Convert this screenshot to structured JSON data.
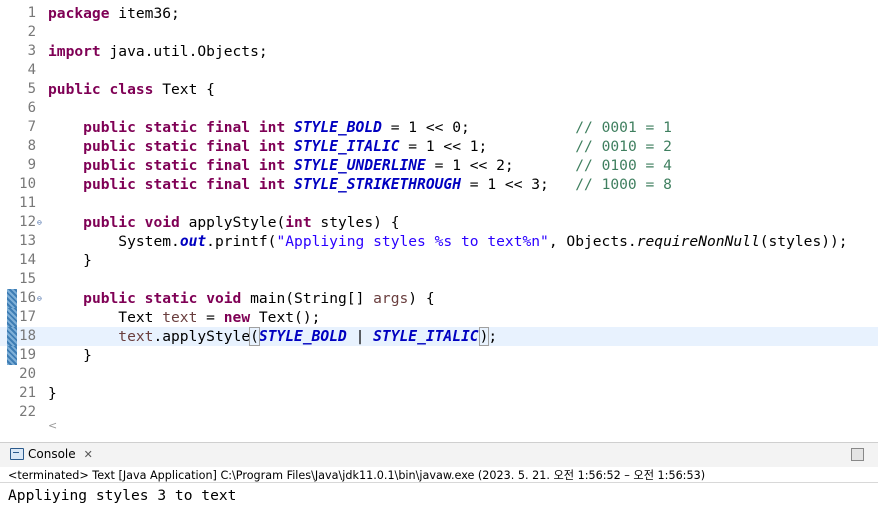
{
  "editor": {
    "lines": {
      "l1": {
        "no": "1",
        "kw1": "package",
        "rest": " item36;"
      },
      "l2": {
        "no": "2"
      },
      "l3": {
        "no": "3",
        "kw1": "import",
        "rest": " java.util.Objects;"
      },
      "l4": {
        "no": "4"
      },
      "l5": {
        "no": "5",
        "kw1": "public",
        "kw2": "class",
        "rest": " Text {"
      },
      "l6": {
        "no": "6"
      },
      "l7": {
        "no": "7",
        "mods": "public static final int",
        "name": "STYLE_BOLD",
        "expr": " = 1 << 0;",
        "pad": "            ",
        "comment": "// 0001 = 1"
      },
      "l8": {
        "no": "8",
        "mods": "public static final int",
        "name": "STYLE_ITALIC",
        "expr": " = 1 << 1;",
        "pad": "          ",
        "comment": "// 0010 = 2"
      },
      "l9": {
        "no": "9",
        "mods": "public static final int",
        "name": "STYLE_UNDERLINE",
        "expr": " = 1 << 2;",
        "pad": "       ",
        "comment": "// 0100 = 4"
      },
      "l10": {
        "no": "10",
        "mods": "public static final int",
        "name": "STYLE_STRIKETHROUGH",
        "expr": " = 1 << 3;",
        "pad": "   ",
        "comment": "// 1000 = 8"
      },
      "l11": {
        "no": "11"
      },
      "l12": {
        "no": "12",
        "kw1": "public",
        "kw2": "void",
        "a": " applyStyle(",
        "kw3": "int",
        "b": " styles) {"
      },
      "l13": {
        "no": "13",
        "a": "System.",
        "field": "out",
        "b": ".printf(",
        "str": "\"Appliying styles %s to text%n\"",
        "c": ", Objects.",
        "method": "requireNonNull",
        "d": "(styles));"
      },
      "l14": {
        "no": "14",
        "text": "}"
      },
      "l15": {
        "no": "15"
      },
      "l16": {
        "no": "16",
        "kw1": "public",
        "kw2": "static",
        "kw3": "void",
        "a": " main(String[] ",
        "var": "args",
        "b": ") {"
      },
      "l17": {
        "no": "17",
        "a": "Text ",
        "var": "text",
        "b": " = ",
        "kw": "new",
        "c": " Text();"
      },
      "l18": {
        "no": "18",
        "var": "text",
        "a": ".applyStyle",
        "open": "(",
        "c1": "STYLE_BOLD",
        "mid": " | ",
        "c2": "STYLE_ITALIC",
        "close": ")",
        "end": ";"
      },
      "l19": {
        "no": "19",
        "text": "}"
      },
      "l20": {
        "no": "20"
      },
      "l21": {
        "no": "21",
        "text": "}"
      },
      "l22": {
        "no": "22"
      }
    },
    "hscroll_glyph": "<"
  },
  "console": {
    "tab_label": "Console",
    "close_glyph": "✕",
    "status": "<terminated> Text [Java Application] C:\\Program Files\\Java\\jdk11.0.1\\bin\\javaw.exe  (2023. 5. 21. 오전 1:56:52 – 오전 1:56:53)",
    "output": "Appliying styles 3 to text"
  },
  "colors": {
    "keyword": "#7f0055",
    "constant": "#0000c0",
    "string": "#2a00ff",
    "comment": "#3f7f5f",
    "local_variable": "#6a3e3e",
    "current_line": "#e8f2fe"
  },
  "icons": [
    "fold-collapse-icon",
    "console-icon",
    "close-icon",
    "console-action-icon"
  ]
}
